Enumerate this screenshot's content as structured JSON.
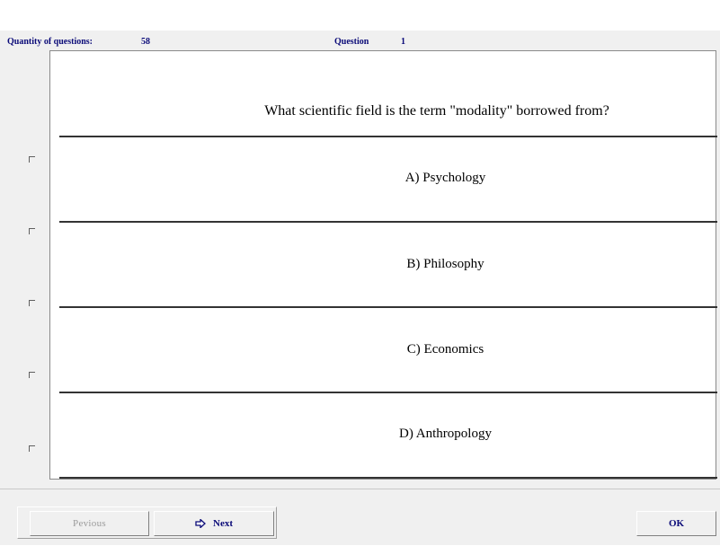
{
  "header": {
    "quantity_label": "Quantity of questions:",
    "quantity_value": "58",
    "question_label": "Question",
    "question_value": "1"
  },
  "question": {
    "text": "What scientific field is the term \"modality\" borrowed from?"
  },
  "answers": [
    {
      "label": "A) Psychology",
      "checked": false
    },
    {
      "label": "B) Philosophy",
      "checked": false
    },
    {
      "label": "C) Economics",
      "checked": false
    },
    {
      "label": "D) Anthropology",
      "checked": false
    }
  ],
  "buttons": {
    "previous": "Pevious",
    "next": "Next",
    "next_icon": "arrow-right-icon",
    "ok": "OK"
  },
  "colors": {
    "label_text": "#0a0a78",
    "disabled_text": "#9a9a9a"
  }
}
